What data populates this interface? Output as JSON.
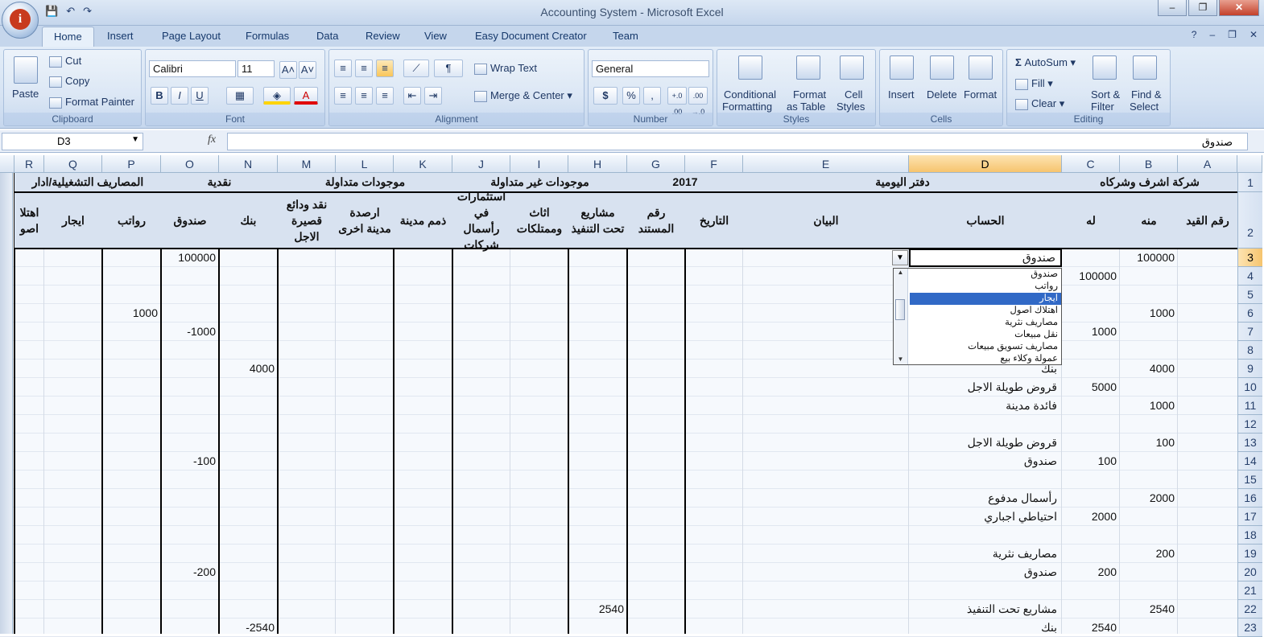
{
  "window": {
    "title": "Accounting System - Microsoft Excel",
    "minimize": "–",
    "restore": "❐",
    "close": "✕"
  },
  "qat": {
    "save": "💾",
    "undo": "↶",
    "redo": "↷"
  },
  "tabs": [
    "Home",
    "Insert",
    "Page Layout",
    "Formulas",
    "Data",
    "Review",
    "View",
    "Easy Document Creator",
    "Team"
  ],
  "ribbon": {
    "clipboard": {
      "paste": "Paste",
      "cut": "Cut",
      "copy": "Copy",
      "format_painter": "Format Painter",
      "label": "Clipboard"
    },
    "font": {
      "name": "Calibri",
      "size": "11",
      "grow": "A˄",
      "shrink": "A˅",
      "bold": "B",
      "italic": "I",
      "underline": "U",
      "font_color": "A",
      "label": "Font"
    },
    "alignment": {
      "wrap_text": "Wrap Text",
      "merge_center": "Merge & Center",
      "label": "Alignment"
    },
    "number": {
      "format": "General",
      "currency": "$",
      "percent": "%",
      "comma": ",",
      "inc_dec": "+.0 .00",
      "dec_dec": ".00 →.0",
      "label": "Number"
    },
    "styles": {
      "conditional": "Conditional",
      "conditional2": "Formatting",
      "format_table": "Format",
      "format_table2": "as Table",
      "cell_styles": "Cell",
      "cell_styles2": "Styles",
      "label": "Styles"
    },
    "cells": {
      "insert": "Insert",
      "delete": "Delete",
      "format": "Format",
      "label": "Cells"
    },
    "editing": {
      "autosum": "AutoSum",
      "fill": "Fill",
      "clear": "Clear",
      "sort_filter": "Sort &",
      "sort_filter2": "Filter",
      "find_select": "Find &",
      "find_select2": "Select",
      "label": "Editing"
    }
  },
  "formula_bar": {
    "name_box": "D3",
    "fx": "fx",
    "value": "صندوق"
  },
  "columns": [
    "A",
    "B",
    "C",
    "D",
    "E",
    "F",
    "G",
    "H",
    "I",
    "J",
    "K",
    "L",
    "M",
    "N",
    "O",
    "P",
    "Q",
    "R"
  ],
  "rows": [
    "1",
    "2",
    "3",
    "4",
    "5",
    "6",
    "7",
    "8",
    "9",
    "10",
    "11",
    "12",
    "13",
    "14",
    "15",
    "16",
    "17",
    "18",
    "19",
    "20",
    "21",
    "22",
    "23"
  ],
  "sheet": {
    "row1": {
      "company": "شركة اشرف وشركاه",
      "journal": "دفتر اليومية",
      "year": "2017",
      "non_current": "موجودات غير متداولة",
      "current": "موجودات متداولة",
      "cash": "نقدية",
      "opex": "المصاريف التشغيلية/ادار"
    },
    "row2": {
      "a": "رقم القيد",
      "b": "منه",
      "c": "له",
      "d": "الحساب",
      "e": "البيان",
      "f": "التاريخ",
      "g": "رقم المستند",
      "h": "مشاريع تحت التنفيذ",
      "i": "اثاث وممتلكات",
      "j": "استثمارات في رأسمال شركات",
      "k": "ذمم مدينة",
      "l": "ارصدة مدينة اخرى",
      "m": "نقد ودائع قصيرة الاجل",
      "n": "بنك",
      "o": "صندوق",
      "p": "رواتب",
      "q": "ايجار",
      "r": "اهتلا اصو"
    },
    "cells": {
      "b3": "100000",
      "d3": "صندوق",
      "o3": "100000",
      "c4": "100000",
      "b6": "1000",
      "p6": "1000",
      "c7": "1000",
      "o7": "-1000",
      "b9": "4000",
      "d9": "بنك",
      "n9": "4000",
      "c10": "5000",
      "d10": "قروض طويلة الاجل",
      "b11": "1000",
      "d11": "فائدة مدينة",
      "b13": "100",
      "d13": "قروض طويلة الاجل",
      "c14": "100",
      "d14": "صندوق",
      "o14": "-100",
      "b16": "2000",
      "d16": "رأسمال مدفوع",
      "c17": "2000",
      "d17": "احتياطي اجباري",
      "b19": "200",
      "d19": "مصاريف نثرية",
      "c20": "200",
      "d20": "صندوق",
      "o20": "-200",
      "b22": "2540",
      "d22": "مشاريع تحت التنفيذ",
      "h22": "2540",
      "c23": "2540",
      "d23": "بنك",
      "n23": "-2540"
    }
  },
  "dropdown": {
    "items": [
      "صندوق",
      "رواتب",
      "ايجار",
      "اهتلاك اصول",
      "مصاريف نثرية",
      "نقل مبيعات",
      "مصاريف تسويق مبيعات",
      "عمولة وكلاء بيع"
    ],
    "selected_index": 2,
    "arrow": "▼",
    "up": "▲",
    "down": "▼"
  }
}
